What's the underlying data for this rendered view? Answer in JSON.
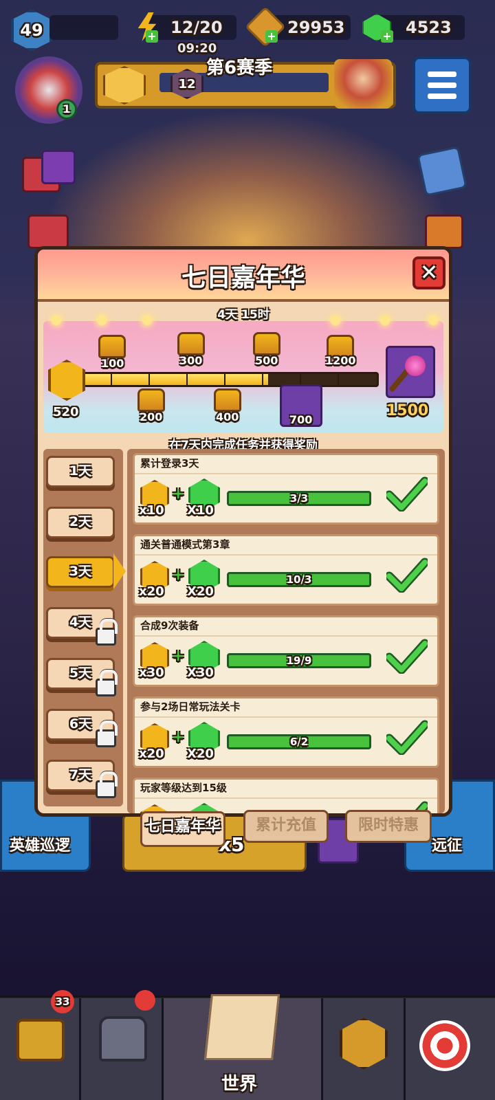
{
  "topbar": {
    "player_level": "49",
    "energy": "12/20",
    "energy_timer": "09:20",
    "coins": "29953",
    "gems": "4523",
    "season_title": "第6赛季",
    "season_level": "12",
    "avatar_badge": "1"
  },
  "background": {
    "left_button": "英雄巡逻",
    "right_button": "远征",
    "center_count": "x5"
  },
  "modal": {
    "title": "七日嘉年华",
    "close_glyph": "✕",
    "timer": "4天 15时",
    "current_points": "520",
    "progress_fraction": 0.63,
    "milestones_top": [
      "100",
      "300",
      "500",
      "1200"
    ],
    "milestones_bottom": [
      "200",
      "400",
      "700"
    ],
    "final_reward_points": "1500",
    "subtitle": "在7天内完成任务并获得奖励",
    "days": [
      {
        "label": "1天"
      },
      {
        "label": "2天"
      },
      {
        "label": "3天"
      },
      {
        "label": "4天"
      },
      {
        "label": "5天"
      },
      {
        "label": "6天"
      },
      {
        "label": "7天"
      }
    ],
    "active_day": "3天",
    "tasks": [
      {
        "name": "累计登录3天",
        "coin_qty": "x10",
        "gem_qty": "X10",
        "progress": "3/3",
        "done": true
      },
      {
        "name": "通关普通模式第3章",
        "coin_qty": "x20",
        "gem_qty": "X20",
        "progress": "10/3",
        "done": true
      },
      {
        "name": "合成9次装备",
        "coin_qty": "x30",
        "gem_qty": "X30",
        "progress": "19/9",
        "done": true
      },
      {
        "name": "参与2场日常玩法关卡",
        "coin_qty": "x20",
        "gem_qty": "X20",
        "progress": "6/2",
        "done": true
      },
      {
        "name": "玩家等级达到15级",
        "coin_qty": "",
        "gem_qty": "",
        "progress": "",
        "done": true
      }
    ],
    "plus_glyph": "+"
  },
  "bottom_tabs": [
    "七日嘉年华",
    "累计充值",
    "限时特惠"
  ],
  "nav": {
    "chest_badge": "33",
    "world_label": "世界"
  },
  "colors": {
    "accent_gold": "#f2b51c",
    "gem_green": "#3fcf4b",
    "close_red": "#e33b36",
    "panel_beige": "#f4d7b4"
  }
}
